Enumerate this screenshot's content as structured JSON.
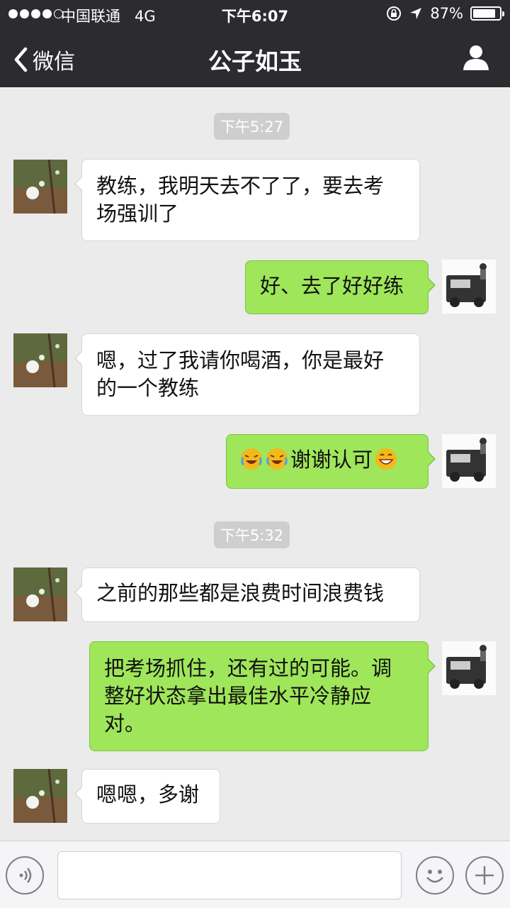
{
  "status_bar": {
    "carrier": "中国联通",
    "network": "4G",
    "time": "下午6:07",
    "battery_percent": "87%",
    "battery_level": 0.87
  },
  "nav": {
    "back_label": "微信",
    "title": "公子如玉"
  },
  "chat": {
    "timestamps": [
      "下午5:27",
      "下午5:32"
    ],
    "messages": [
      {
        "text_line1": "教练，我明天去不了了，要去考",
        "text_line2": "场强训了"
      },
      {
        "text": "好、去了好好练"
      },
      {
        "text_line1": "嗯，过了我请你喝酒，你是最好",
        "text_line2": "的一个教练"
      },
      {
        "text": "谢谢认可",
        "emojis": [
          "crying-laughing-emoji",
          "crying-laughing-emoji",
          "grinning-emoji"
        ]
      },
      {
        "text": "之前的那些都是浪费时间浪费钱"
      },
      {
        "text_line1": "把考场抓住，还有过的可能。调",
        "text_line2": "整好状态拿出最佳水平冷静应",
        "text_line3": "对。"
      },
      {
        "text": "嗯嗯，多谢"
      }
    ]
  },
  "input_bar": {
    "voice_icon": "voice-icon",
    "emoji_icon": "emoji-icon",
    "plus_icon": "plus-icon",
    "text_value": ""
  },
  "colors": {
    "nav_bg": "#2b2b30",
    "chat_bg": "#ebebeb",
    "sent_bubble": "#9fe65a",
    "received_bubble": "#ffffff"
  }
}
